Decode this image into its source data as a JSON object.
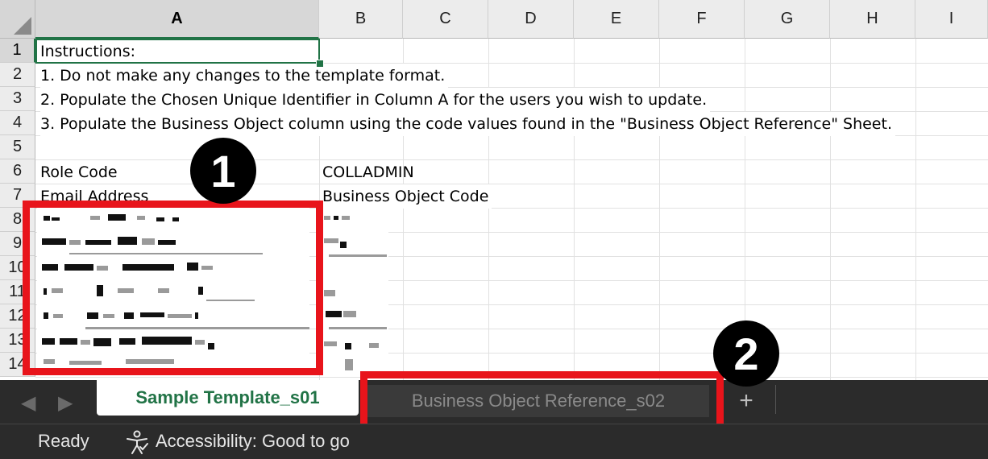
{
  "columns": [
    "A",
    "B",
    "C",
    "D",
    "E",
    "F",
    "G",
    "H",
    "I"
  ],
  "rows": [
    "1",
    "2",
    "3",
    "4",
    "5",
    "6",
    "7",
    "8",
    "9",
    "10",
    "11",
    "12",
    "13",
    "14"
  ],
  "cells": {
    "a1": "Instructions:",
    "a2": "1. Do not make any changes to the template format.",
    "a3": "2. Populate the Chosen Unique Identifier in Column A for the users you wish to update.",
    "a4": "3. Populate the Business Object column using the code values found in the \"Business Object Reference\" Sheet.",
    "a6": "Role Code",
    "b6": "COLLADMIN",
    "a7": "Email Address",
    "b7": "Business Object Code"
  },
  "annotations": {
    "callout_1": "1",
    "callout_2": "2",
    "highlight_color": "#e8141b"
  },
  "tabs": {
    "active": "Sample Template_s01",
    "inactive": "Business Object Reference_s02",
    "add_label": "+",
    "prev_icon": "chevron-left",
    "next_icon": "chevron-right"
  },
  "status": {
    "ready": "Ready",
    "accessibility": "Accessibility: Good to go"
  },
  "theme": {
    "accent": "#217346",
    "tabbar_bg": "#2b2b2b"
  }
}
